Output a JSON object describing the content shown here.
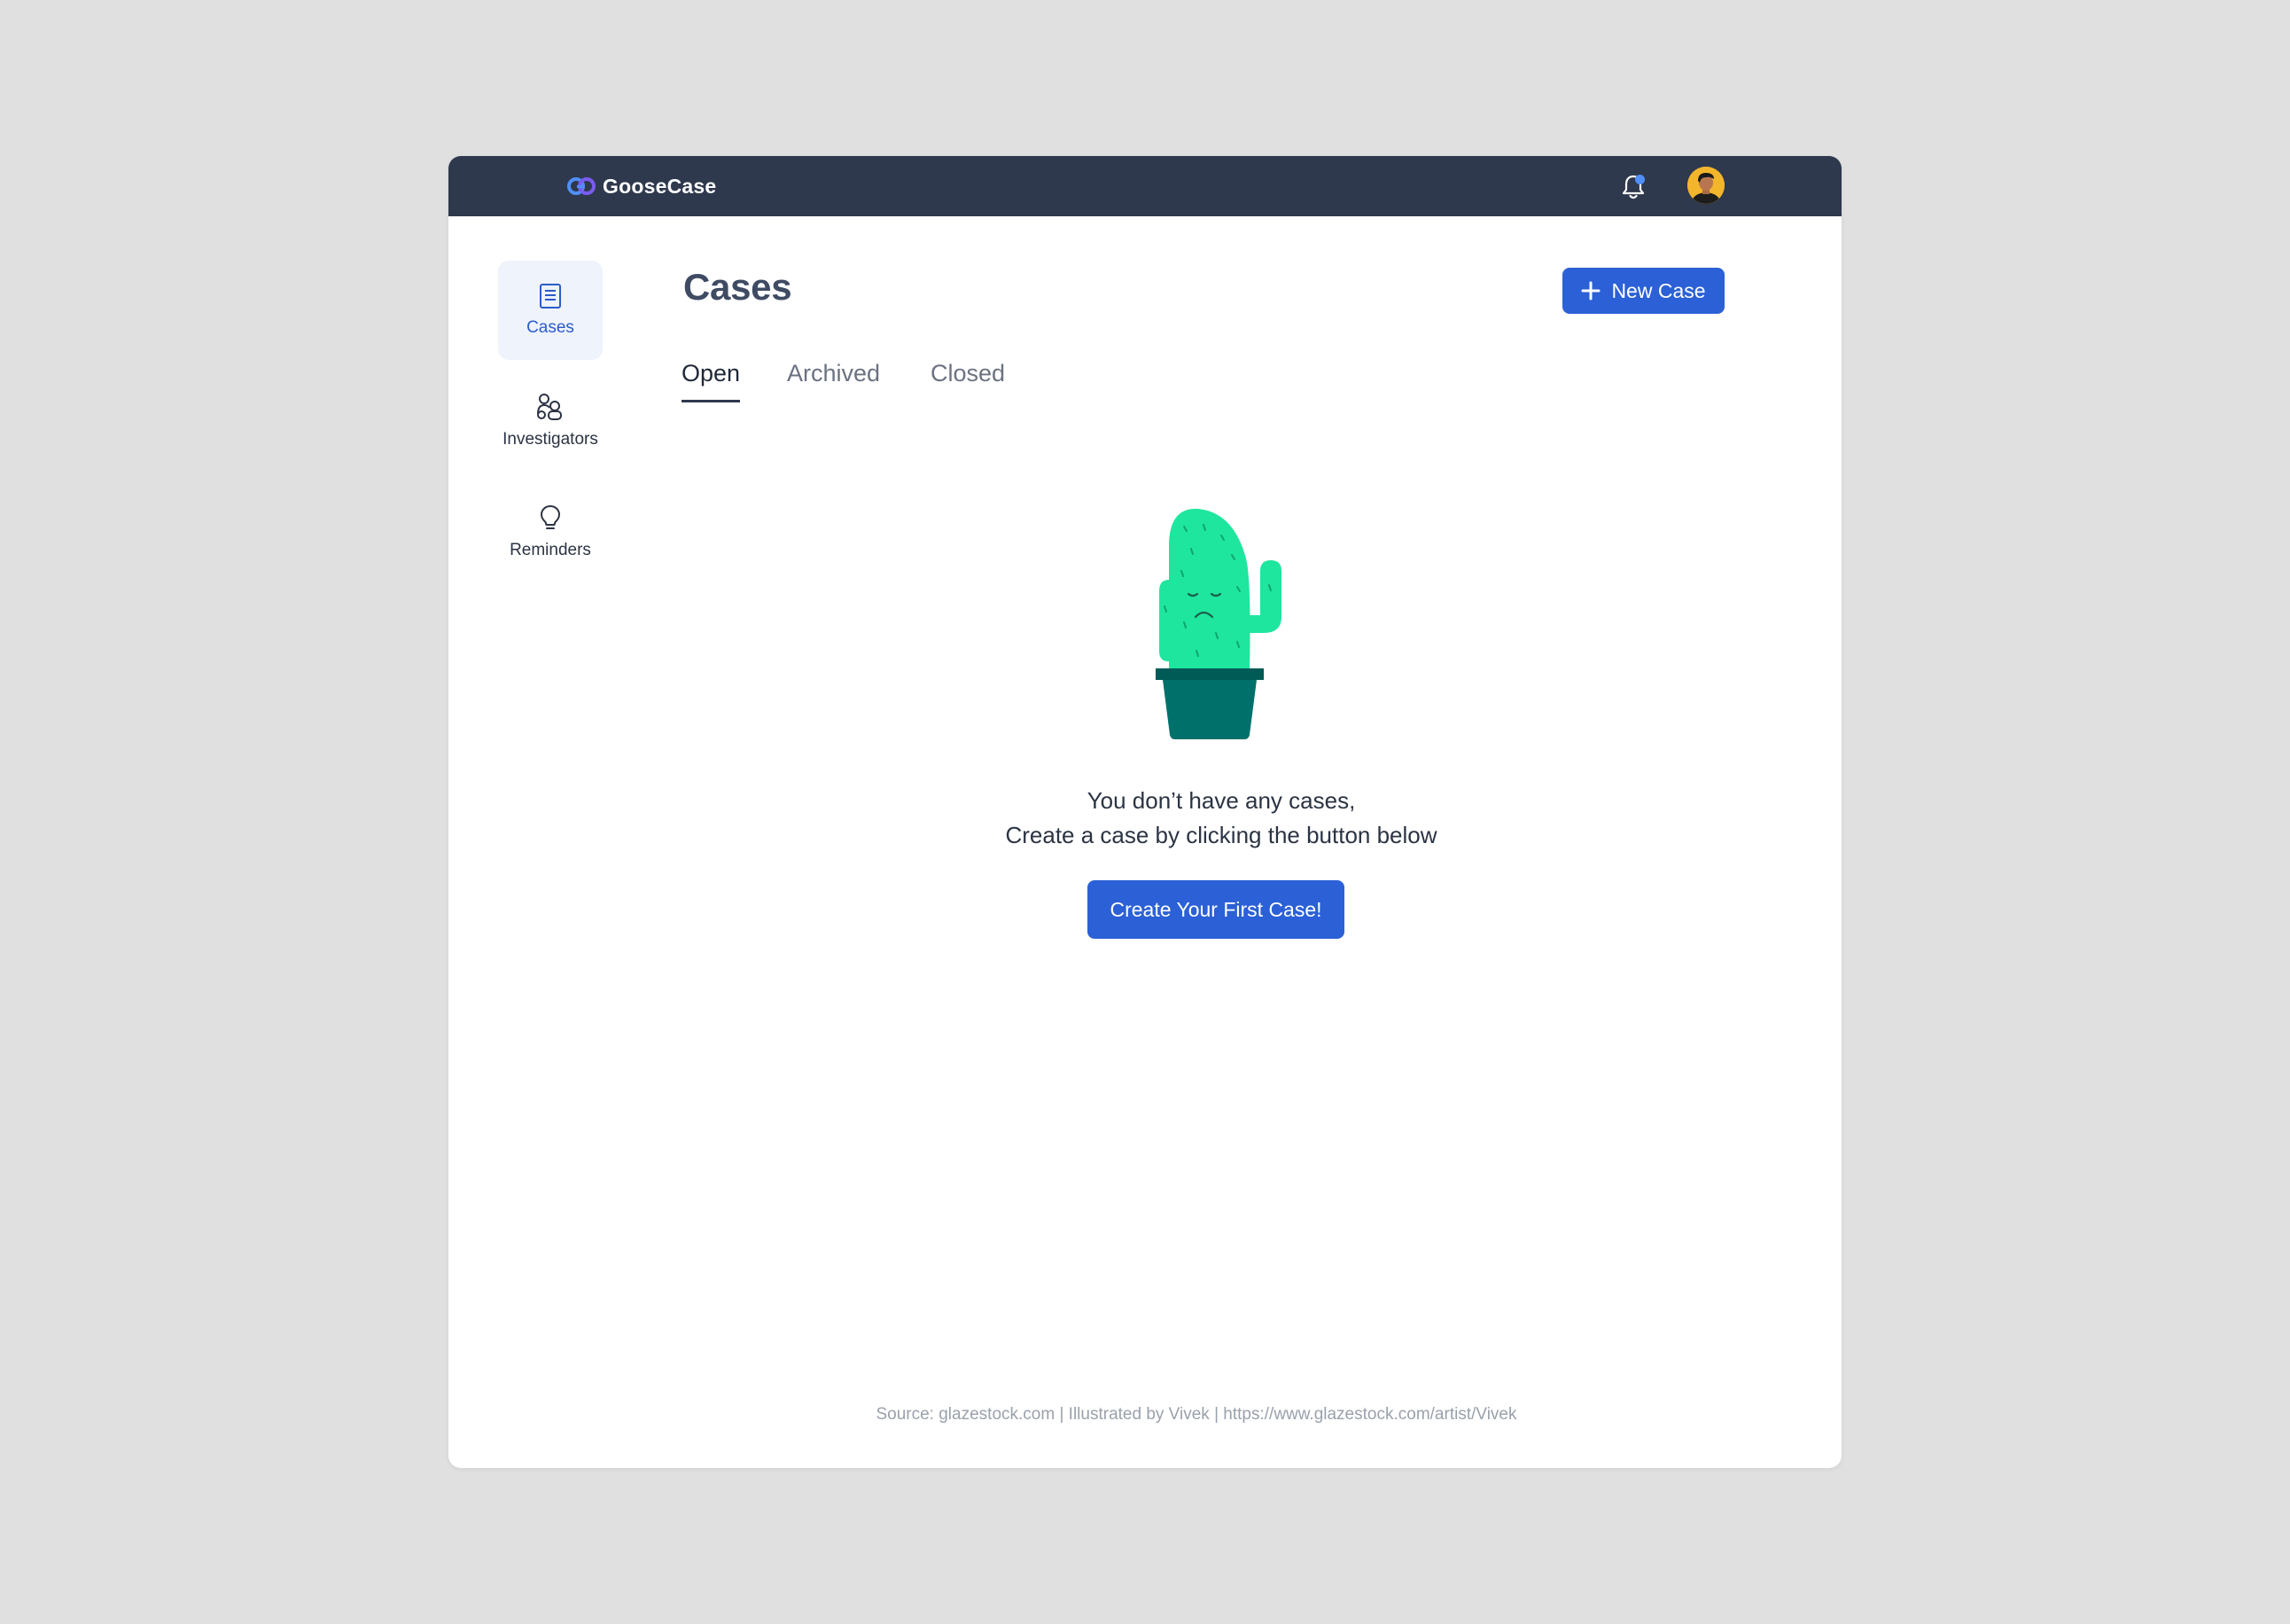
{
  "app": {
    "name": "GooseCase"
  },
  "header": {
    "notification_icon": "bell-icon",
    "has_notification": true,
    "avatar_icon": "user-avatar"
  },
  "sidebar": {
    "items": [
      {
        "label": "Cases",
        "icon": "document-icon",
        "active": true
      },
      {
        "label": "Investigators",
        "icon": "people-icon",
        "active": false
      },
      {
        "label": "Reminders",
        "icon": "lightbulb-icon",
        "active": false
      }
    ]
  },
  "main": {
    "title": "Cases",
    "new_case_label": "New Case",
    "tabs": [
      {
        "label": "Open",
        "active": true
      },
      {
        "label": "Archived",
        "active": false
      },
      {
        "label": "Closed",
        "active": false
      }
    ],
    "empty_state": {
      "line1": "You don’t have any cases,",
      "line2": "Create a case by clicking the button below",
      "button_label": "Create Your First Case!"
    },
    "credit": "Source: glazestock.com |  Illustrated by Vivek  |  https://www.glazestock.com/artist/Vivek"
  },
  "colors": {
    "topbar": "#2e394d",
    "accent": "#2b60d6",
    "active_nav_bg": "#eef3fc",
    "cactus": "#1ee69e",
    "pot": "#00716a"
  }
}
